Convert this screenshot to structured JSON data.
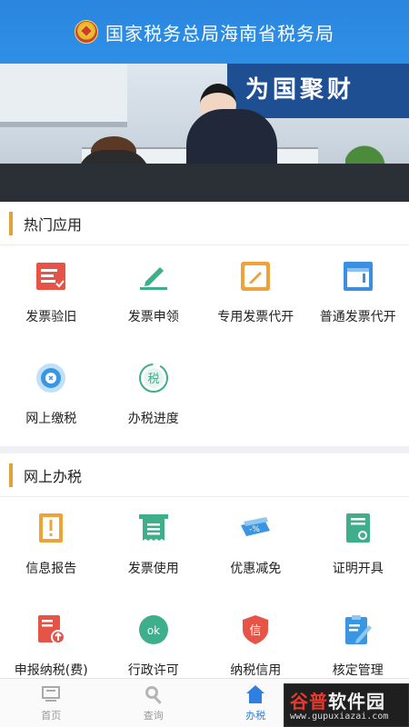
{
  "header": {
    "title": "国家税务总局海南省税务局"
  },
  "banner": {
    "wall_text": "为国聚财"
  },
  "hot_apps": {
    "title": "热门应用",
    "items": [
      {
        "label": "发票验旧",
        "icon": "invoice-check-icon"
      },
      {
        "label": "发票申领",
        "icon": "invoice-apply-icon"
      },
      {
        "label": "专用发票代开",
        "icon": "special-invoice-icon"
      },
      {
        "label": "普通发票代开",
        "icon": "general-invoice-icon"
      },
      {
        "label": "网上缴税",
        "icon": "online-tax-payment-icon"
      },
      {
        "label": "办税进度",
        "icon": "tax-progress-icon"
      }
    ]
  },
  "online_tax": {
    "title": "网上办税",
    "items": [
      {
        "label": "信息报告",
        "icon": "info-report-icon"
      },
      {
        "label": "发票使用",
        "icon": "invoice-use-icon"
      },
      {
        "label": "优惠减免",
        "icon": "discount-icon"
      },
      {
        "label": "证明开具",
        "icon": "certificate-icon"
      },
      {
        "label": "申报纳税(费)",
        "icon": "tax-declare-icon"
      },
      {
        "label": "行政许可",
        "icon": "admin-license-icon"
      },
      {
        "label": "纳税信用",
        "icon": "tax-credit-icon"
      },
      {
        "label": "核定管理",
        "icon": "assessment-icon"
      }
    ]
  },
  "tabbar": {
    "tabs": [
      {
        "label": "首页",
        "icon": "home-icon",
        "active": false
      },
      {
        "label": "查询",
        "icon": "search-icon",
        "active": false
      },
      {
        "label": "办税",
        "icon": "tax-house-icon",
        "active": true
      }
    ]
  },
  "watermark": {
    "name_red": "谷普",
    "name_white": "软件园",
    "url": "www.gupuxiazai.com"
  },
  "colors": {
    "header_blue": "#2f8fe6",
    "accent_orange": "#e2a23a",
    "active_tab": "#2f7fe0"
  }
}
